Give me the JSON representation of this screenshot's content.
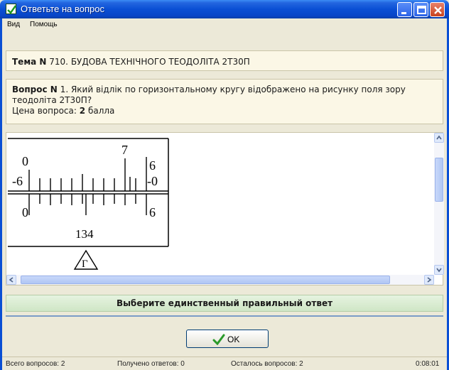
{
  "window": {
    "title": "Ответьте на вопрос"
  },
  "menu": {
    "items": [
      "Вид",
      "Помощь"
    ]
  },
  "topic": {
    "label": "Тема N",
    "text": "710. БУДОВА ТЕХНІЧНОГО ТЕОДОЛІТА 2Т30П"
  },
  "question": {
    "label": "Вопрос N",
    "text": "1. Який відлік по горизонтальному кругу відображено на рисунку поля зору теодоліта 2Т30П?",
    "price_label": "Цена вопроса:",
    "price_value": "2",
    "price_unit": "балла"
  },
  "figure": {
    "upper_left_top": "0",
    "upper_left_bottom": "-6",
    "upper_mid": "7",
    "upper_right_top": "6",
    "upper_right_bottom": "-0",
    "lower_left": "0",
    "lower_right": "6",
    "lower_mid": "134",
    "triangle_letter": "Г"
  },
  "instruction": {
    "text": "Выберите единственный правильный ответ"
  },
  "ok_button": {
    "label": "OK"
  },
  "status": {
    "total": "Всего вопросов: 2",
    "answered": "Получено ответов: 0",
    "remaining": "Осталось вопросов: 2",
    "time": "0:08:01"
  },
  "colors": {
    "titlebar": "#0a4fd4",
    "instruction_bg": "#d8ecd0",
    "ok_check": "#2a9a2a"
  }
}
